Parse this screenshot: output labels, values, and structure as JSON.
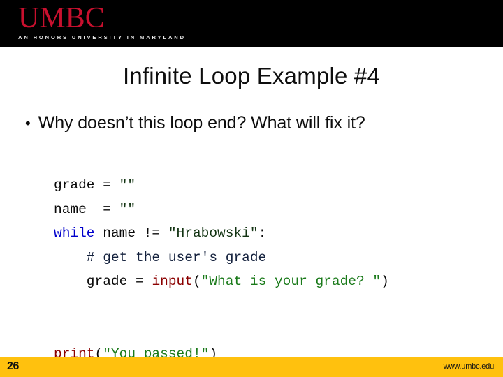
{
  "header": {
    "logo_wordmark": "UMBC",
    "logo_tagline": "AN HONORS UNIVERSITY IN MARYLAND",
    "logo_color": "#c8102e",
    "band_color": "#000000"
  },
  "slide": {
    "title": "Infinite Loop Example #4",
    "bullet_marker": "•",
    "bullet_text": "Why doesn’t this loop end?  What will fix it?"
  },
  "code": {
    "lines": [
      {
        "id": "line-grade-init",
        "tokens": [
          {
            "text": "grade = ",
            "type": "plain"
          },
          {
            "text": "\"\"",
            "type": "str-dark"
          }
        ]
      },
      {
        "id": "line-name-init",
        "tokens": [
          {
            "text": "name  = ",
            "type": "plain"
          },
          {
            "text": "\"\"",
            "type": "str-dark"
          }
        ]
      },
      {
        "id": "line-while",
        "tokens": [
          {
            "text": "while",
            "type": "kw"
          },
          {
            "text": " name != ",
            "type": "plain"
          },
          {
            "text": "\"Hrabowski\"",
            "type": "str-dark"
          },
          {
            "text": ":",
            "type": "plain"
          }
        ]
      },
      {
        "id": "line-comment",
        "tokens": [
          {
            "text": "    # get the user's grade",
            "type": "comment"
          }
        ]
      },
      {
        "id": "line-input",
        "tokens": [
          {
            "text": "    grade = ",
            "type": "plain"
          },
          {
            "text": "input",
            "type": "fn"
          },
          {
            "text": "(",
            "type": "plain"
          },
          {
            "text": "\"What is your grade? \"",
            "type": "str"
          },
          {
            "text": ")",
            "type": "plain"
          }
        ]
      },
      {
        "id": "line-blank-1",
        "tokens": [
          {
            "text": " ",
            "type": "plain"
          }
        ]
      },
      {
        "id": "line-blank-2",
        "tokens": [
          {
            "text": " ",
            "type": "plain"
          }
        ]
      },
      {
        "id": "line-print",
        "tokens": [
          {
            "text": "print",
            "type": "fn"
          },
          {
            "text": "(",
            "type": "plain"
          },
          {
            "text": "\"You passed!\"",
            "type": "str"
          },
          {
            "text": ")",
            "type": "plain"
          }
        ]
      }
    ],
    "colors": {
      "keyword": "#0000cc",
      "function": "#8b0000",
      "string": "#1a7a1a",
      "string_dark": "#123312",
      "comment": "#14213d",
      "plain": "#0a0a0a"
    }
  },
  "footer": {
    "slide_number": "26",
    "url": "www.umbc.edu",
    "band_color": "#ffc10e"
  }
}
